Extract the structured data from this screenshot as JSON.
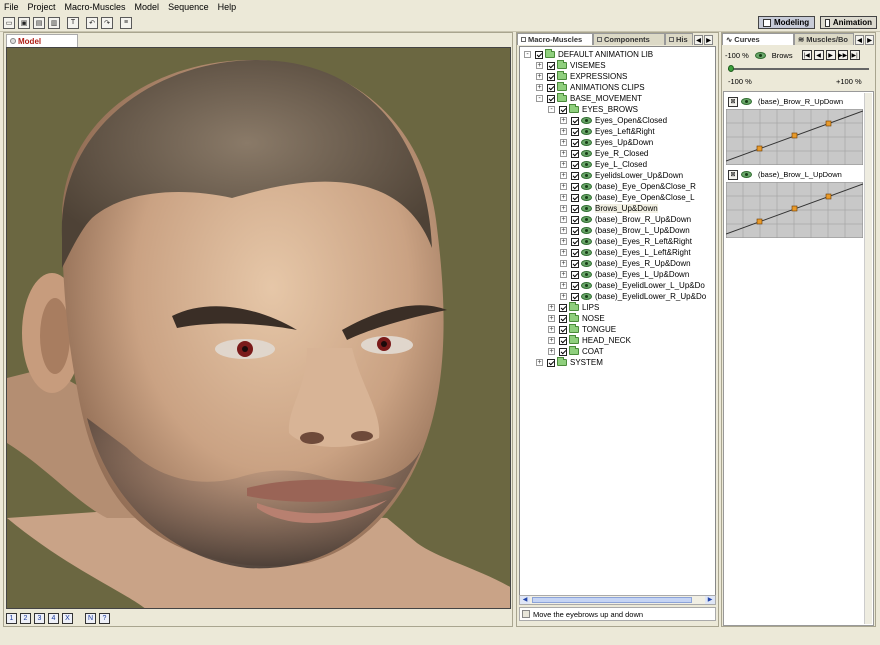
{
  "menu": [
    "File",
    "Project",
    "Macro-Muscles",
    "Model",
    "Sequence",
    "Help"
  ],
  "menu_underline": [
    "F",
    "P",
    "c",
    "M",
    "S",
    "H"
  ],
  "toolbar_icons": [
    "open-icon",
    "save-icon",
    "import-icon",
    "export-icon",
    "text-icon",
    "undo-icon",
    "redo-icon",
    "settings-icon"
  ],
  "modes": {
    "modeling": "Modeling",
    "animation": "Animation"
  },
  "viewport": {
    "tab_label": "Model",
    "footer_buttons": [
      "1",
      "2",
      "3",
      "4",
      "X",
      "N",
      "?"
    ]
  },
  "library": {
    "tabs": [
      "Macro-Muscles",
      "Components",
      "His"
    ],
    "status_text": "Move the eyebrows up and down",
    "tree": [
      {
        "level": 0,
        "label": "DEFAULT ANIMATION LIB",
        "type": "folder",
        "exp": "-"
      },
      {
        "level": 1,
        "label": "VISEMES",
        "type": "folder",
        "exp": "+"
      },
      {
        "level": 1,
        "label": "EXPRESSIONS",
        "type": "folder",
        "exp": "+"
      },
      {
        "level": 1,
        "label": "ANIMATIONS CLIPS",
        "type": "folder",
        "exp": "+"
      },
      {
        "level": 1,
        "label": "BASE_MOVEMENT",
        "type": "folder",
        "exp": "-"
      },
      {
        "level": 2,
        "label": "EYES_BROWS",
        "type": "folder",
        "exp": "-"
      },
      {
        "level": 3,
        "label": "Eyes_Open&Closed",
        "type": "item",
        "exp": "+"
      },
      {
        "level": 3,
        "label": "Eyes_Left&Right",
        "type": "item",
        "exp": "+"
      },
      {
        "level": 3,
        "label": "Eyes_Up&Down",
        "type": "item",
        "exp": "+"
      },
      {
        "level": 3,
        "label": "Eye_R_Closed",
        "type": "item",
        "exp": "+"
      },
      {
        "level": 3,
        "label": "Eye_L_Closed",
        "type": "item",
        "exp": "+"
      },
      {
        "level": 3,
        "label": "EyelidsLower_Up&Down",
        "type": "item",
        "exp": "+"
      },
      {
        "level": 3,
        "label": "(base)_Eye_Open&Close_R",
        "type": "item",
        "exp": "+"
      },
      {
        "level": 3,
        "label": "(base)_Eye_Open&Close_L",
        "type": "item",
        "exp": "+"
      },
      {
        "level": 3,
        "label": "Brows_Up&Down",
        "type": "item",
        "exp": "+",
        "selected": true
      },
      {
        "level": 3,
        "label": "(base)_Brow_R_Up&Down",
        "type": "item",
        "exp": "+"
      },
      {
        "level": 3,
        "label": "(base)_Brow_L_Up&Down",
        "type": "item",
        "exp": "+"
      },
      {
        "level": 3,
        "label": "(base)_Eyes_R_Left&Right",
        "type": "item",
        "exp": "+"
      },
      {
        "level": 3,
        "label": "(base)_Eyes_L_Left&Right",
        "type": "item",
        "exp": "+"
      },
      {
        "level": 3,
        "label": "(base)_Eyes_R_Up&Down",
        "type": "item",
        "exp": "+"
      },
      {
        "level": 3,
        "label": "(base)_Eyes_L_Up&Down",
        "type": "item",
        "exp": "+"
      },
      {
        "level": 3,
        "label": "(base)_EyelidLower_L_Up&Do",
        "type": "item",
        "exp": "+"
      },
      {
        "level": 3,
        "label": "(base)_EyelidLower_R_Up&Do",
        "type": "item",
        "exp": "+"
      },
      {
        "level": 2,
        "label": "LIPS",
        "type": "folder",
        "exp": "+"
      },
      {
        "level": 2,
        "label": "NOSE",
        "type": "folder",
        "exp": "+"
      },
      {
        "level": 2,
        "label": "TONGUE",
        "type": "folder",
        "exp": "+"
      },
      {
        "level": 2,
        "label": "HEAD_NECK",
        "type": "folder",
        "exp": "+"
      },
      {
        "level": 2,
        "label": "COAT",
        "type": "folder",
        "exp": "+"
      },
      {
        "level": 1,
        "label": "SYSTEM",
        "type": "folder",
        "exp": "+"
      }
    ]
  },
  "curves_panel": {
    "tabs": [
      "Curves",
      "Muscles/Bo"
    ],
    "slider_value_label": "-100 %",
    "slider_name": "Brows",
    "slider_value": -100,
    "range_min": "-100 %",
    "range_max": "+100 %",
    "transport": [
      "first-frame-icon",
      "prev-frame-icon",
      "play-icon",
      "next-frame-icon",
      "last-frame-icon"
    ],
    "curves": [
      {
        "label": "(base)_Brow_R_UpDown"
      },
      {
        "label": "(base)_Brow_L_UpDown"
      }
    ]
  },
  "colors": {
    "accent_tab": "#b02018",
    "viewport_bg": "#6b6741",
    "folder": "#8fcf7d",
    "selection": "#c7cbd7"
  }
}
